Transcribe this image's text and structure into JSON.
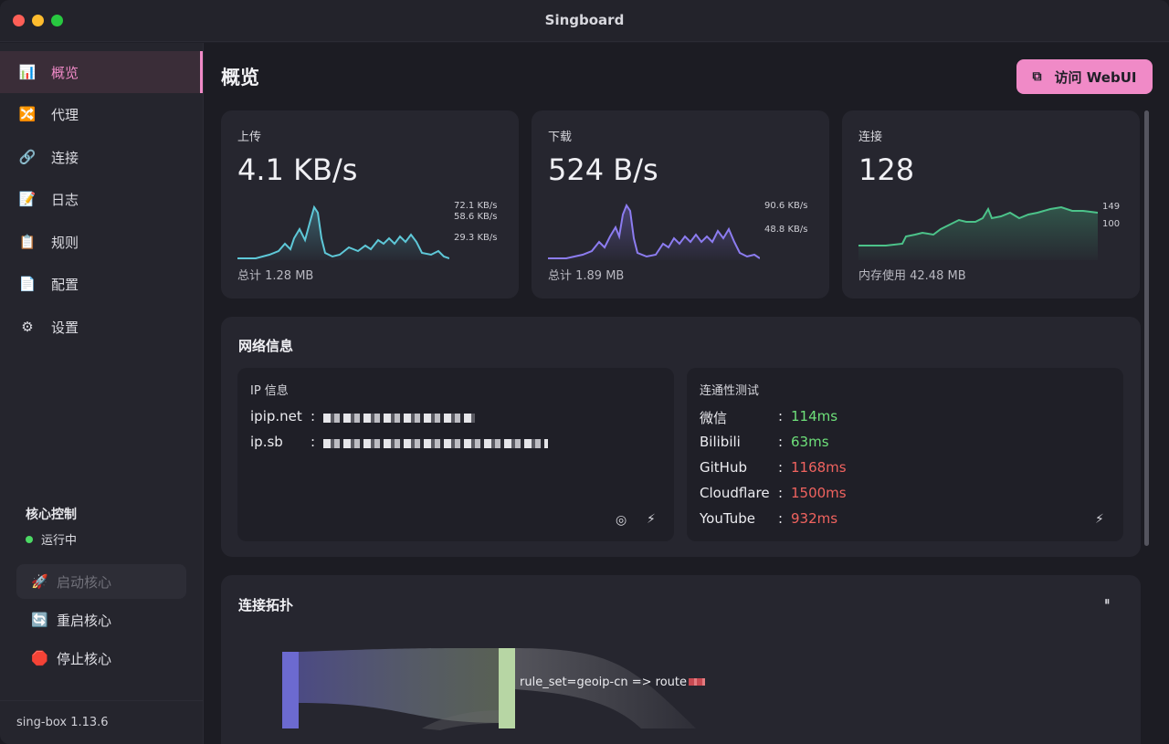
{
  "window": {
    "title": "Singboard"
  },
  "sidebar": {
    "items": [
      {
        "label": "概览",
        "icon": "bar-chart-icon",
        "glyph": "📊",
        "active": true
      },
      {
        "label": "代理",
        "icon": "shuffle-icon",
        "glyph": "🔀"
      },
      {
        "label": "连接",
        "icon": "link-icon",
        "glyph": "🔗"
      },
      {
        "label": "日志",
        "icon": "memo-icon",
        "glyph": "📝"
      },
      {
        "label": "规则",
        "icon": "clipboard-icon",
        "glyph": "📋"
      },
      {
        "label": "配置",
        "icon": "document-icon",
        "glyph": "📄"
      },
      {
        "label": "设置",
        "icon": "gear-icon",
        "glyph": "⚙"
      }
    ],
    "core": {
      "title": "核心控制",
      "status": "运行中",
      "start": {
        "label": "启动核心",
        "glyph": "🚀"
      },
      "restart": {
        "label": "重启核心",
        "glyph": "🔄"
      },
      "stop": {
        "label": "停止核心",
        "glyph": "🛑"
      }
    },
    "version": "sing-box 1.13.6"
  },
  "header": {
    "title": "概览",
    "webui_label": "访问 WebUI",
    "webui_icon": "external-link-icon"
  },
  "stats": {
    "upload": {
      "label": "上传",
      "value": "4.1 KB/s",
      "footer": "总计 1.28 MB",
      "ticks": [
        "72.1 KB/s",
        "58.6 KB/s",
        "29.3 KB/s"
      ],
      "color": "#5ec8d8"
    },
    "download": {
      "label": "下载",
      "value": "524 B/s",
      "footer": "总计 1.89 MB",
      "ticks": [
        "90.6 KB/s",
        "48.8 KB/s"
      ],
      "color": "#8c7cf0"
    },
    "connections": {
      "label": "连接",
      "value": "128",
      "footer": "内存使用 42.48 MB",
      "ticks": [
        "149",
        "100"
      ],
      "color": "#4cc38a"
    }
  },
  "network": {
    "title": "网络信息",
    "ip": {
      "title": "IP 信息",
      "rows": [
        {
          "key": "ipip.net",
          "sep": ":"
        },
        {
          "key": "ip.sb",
          "sep": ":"
        }
      ]
    },
    "connectivity": {
      "title": "连通性测试",
      "rows": [
        {
          "name": "微信",
          "sep": ":",
          "latency": "114ms",
          "status": "good"
        },
        {
          "name": "Bilibili",
          "sep": ":",
          "latency": "63ms",
          "status": "good"
        },
        {
          "name": "GitHub",
          "sep": ":",
          "latency": "1168ms",
          "status": "bad"
        },
        {
          "name": "Cloudflare",
          "sep": ":",
          "latency": "1500ms",
          "status": "bad"
        },
        {
          "name": "YouTube",
          "sep": ":",
          "latency": "932ms",
          "status": "bad"
        }
      ]
    }
  },
  "topology": {
    "title": "连接拓扑",
    "pause_glyph": "⏸",
    "node_label": "rule_set=geoip-cn => route"
  }
}
